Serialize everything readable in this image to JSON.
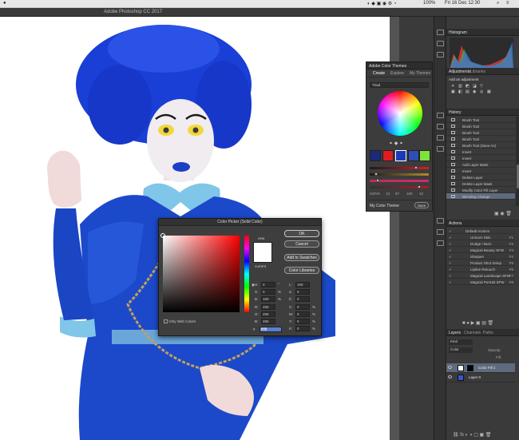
{
  "menubar": {
    "battery": "100%",
    "datetime": "Fri 16 Dec  12:30"
  },
  "app_title": "Adobe Photoshop CC 2017",
  "colors": {
    "accent": "#5d6b7d",
    "hair": "#1a3fd6",
    "suit": "#1c49c9",
    "collar": "#7fc6e8"
  },
  "color_themes": {
    "title": "Adobe Color Themes",
    "tabs": [
      "Create",
      "Explore",
      "My Themes"
    ],
    "rule": "Triad",
    "mode_label": "CMYK",
    "mode_values": [
      "13",
      "97",
      "100",
      "10"
    ],
    "theme_name": "My Color Theme",
    "save_label": "Save",
    "swatches": [
      "#1b2a7a",
      "#e01b24",
      "#1c3ab8",
      "#2e4db5",
      "#7ee23b"
    ]
  },
  "color_picker": {
    "title": "Color Picker (Solid Color)",
    "new_label": "new",
    "current_label": "current",
    "ok_label": "OK",
    "cancel_label": "Cancel",
    "add_swatches_label": "Add to Swatches",
    "libraries_label": "Color Libraries",
    "web_colors_label": "Only Web Colors",
    "hsb": [
      {
        "k": "H:",
        "v": "0",
        "u": "°"
      },
      {
        "k": "S:",
        "v": "0",
        "u": "%"
      },
      {
        "k": "B:",
        "v": "100",
        "u": "%"
      }
    ],
    "rgb": [
      {
        "k": "R:",
        "v": "255"
      },
      {
        "k": "G:",
        "v": "255"
      },
      {
        "k": "B:",
        "v": "255"
      }
    ],
    "lab": [
      {
        "k": "L:",
        "v": "100"
      },
      {
        "k": "a:",
        "v": "0"
      },
      {
        "k": "b:",
        "v": "0"
      }
    ],
    "cmyk": [
      {
        "k": "C:",
        "v": "0",
        "u": "%"
      },
      {
        "k": "M:",
        "v": "0",
        "u": "%"
      },
      {
        "k": "Y:",
        "v": "0",
        "u": "%"
      },
      {
        "k": "K:",
        "v": "0",
        "u": "%"
      }
    ],
    "hex_label": "#",
    "hex": "ffffff"
  },
  "panels": {
    "histogram": "Histogram",
    "adjustments": "Adjustments",
    "libraries": "Libraries",
    "add_adjustment": "Add an adjustment",
    "history": "History",
    "actions": "Actions",
    "layers": "Layers",
    "channels": "Channels",
    "paths": "Paths"
  },
  "history": [
    "Brush Tool",
    "Brush Tool",
    "Brush Tool",
    "Brush Tool",
    "Brush Tool (Save As)",
    "Invert",
    "Invert",
    "Add Layer Mask",
    "Invert",
    "Delete Layer",
    "Delete Layer Mask",
    "Modify Color Fill Layer",
    "Blending Change"
  ],
  "actions": [
    {
      "label": "Default Actions",
      "key": ""
    },
    {
      "label": "Unicorn Skin",
      "key": "F1"
    },
    {
      "label": "Dodge / Burn",
      "key": "F2"
    },
    {
      "label": "Magical Beauty SFW",
      "key": "F3"
    },
    {
      "label": "Sharpen",
      "key": "F4"
    },
    {
      "label": "Product Shot Setup",
      "key": "F5"
    },
    {
      "label": "Lipline Retouch",
      "key": "F6"
    },
    {
      "label": "Magical Landscape SFW",
      "key": "F7"
    },
    {
      "label": "Magical Portrait SFW",
      "key": "F8"
    }
  ],
  "layers": {
    "kind": "Kind",
    "blend": "Color",
    "opacity_label": "Opacity:",
    "fill_label": "Fill:",
    "items": [
      "Color Fill 1",
      "Layer 0"
    ]
  }
}
